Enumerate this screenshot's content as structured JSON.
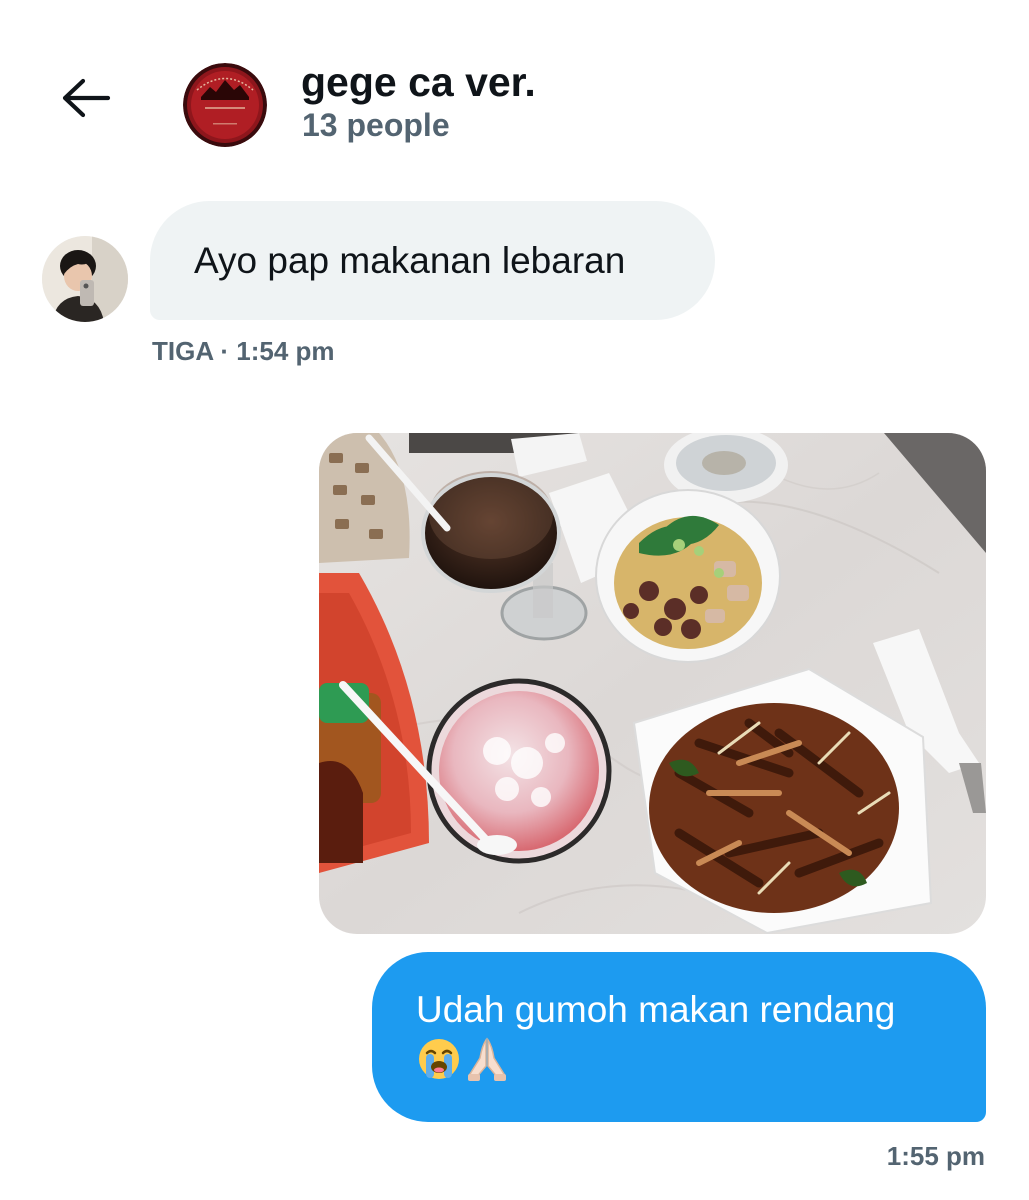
{
  "header": {
    "back_icon": "arrow-left-icon",
    "group_name": "gege ca ver.",
    "member_count": "13 people"
  },
  "messages": [
    {
      "sender": "TIGA",
      "text": "Ayo pap makanan lebaran",
      "meta": "TIGA · 1:54 pm"
    },
    {
      "type": "photo"
    },
    {
      "text": "Udah gumoh makan rendang",
      "emojis": [
        "loudly-crying-face-icon",
        "folded-hands-icon"
      ],
      "time": "1:55 pm"
    }
  ],
  "colors": {
    "accent": "#1d9bf0",
    "incoming_bubble": "#eff3f4",
    "secondary_text": "#536471",
    "primary_text": "#0f1419"
  }
}
